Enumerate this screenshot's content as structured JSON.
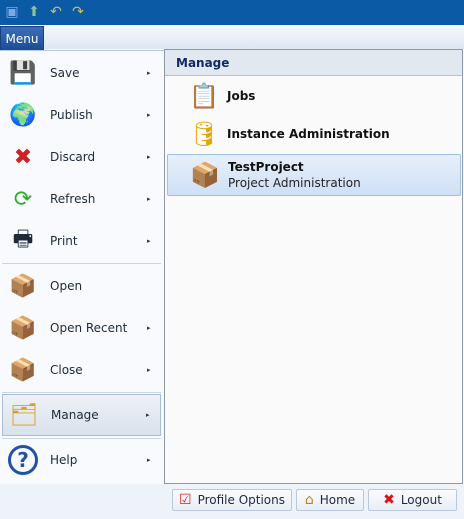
{
  "quick_access": [
    {
      "icon": "save-icon"
    },
    {
      "icon": "publish-icon"
    },
    {
      "icon": "undo-icon"
    },
    {
      "icon": "redo-icon"
    }
  ],
  "menu_tab": "Menu",
  "menu_items": [
    {
      "label": "Save",
      "icon": "floppy-disk-icon",
      "submenu": true
    },
    {
      "label": "Publish",
      "icon": "globe-upload-icon",
      "submenu": true
    },
    {
      "label": "Discard",
      "icon": "discard-document-icon",
      "submenu": true
    },
    {
      "label": "Refresh",
      "icon": "refresh-document-icon",
      "submenu": true
    },
    {
      "label": "Print",
      "icon": "printer-icon",
      "submenu": true
    },
    {
      "label": "Open",
      "icon": "open-box-icon",
      "submenu": false
    },
    {
      "label": "Open Recent",
      "icon": "open-recent-box-icon",
      "submenu": true
    },
    {
      "label": "Close",
      "icon": "close-box-icon",
      "submenu": true
    },
    {
      "label": "Manage",
      "icon": "manage-icon",
      "submenu": true,
      "selected": true
    },
    {
      "label": "Help",
      "icon": "help-icon",
      "submenu": true
    }
  ],
  "submenu_arrow": "▸",
  "manage_panel": {
    "title": "Manage",
    "items": [
      {
        "title": "Jobs",
        "subtitle": "",
        "icon": "clipboard-clock-icon"
      },
      {
        "title": "Instance Administration",
        "subtitle": "",
        "icon": "database-play-icon"
      },
      {
        "title": "TestProject",
        "subtitle": "Project Administration",
        "icon": "project-box-icon",
        "selected": true
      }
    ]
  },
  "footer": {
    "profile_options": "Profile Options",
    "home": "Home",
    "logout": "Logout"
  }
}
